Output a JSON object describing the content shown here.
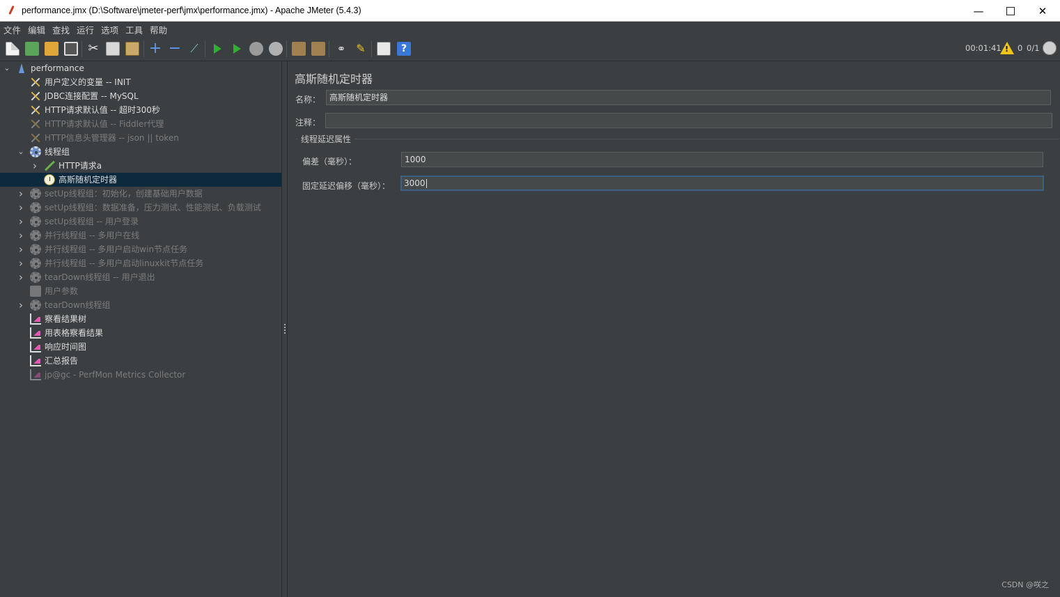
{
  "window": {
    "title": "performance.jmx (D:\\Software\\jmeter-perf\\jmx\\performance.jmx) - Apache JMeter (5.4.3)",
    "minimize": "—",
    "maximize": "",
    "close": "✕"
  },
  "menu": [
    "文件",
    "编辑",
    "查找",
    "运行",
    "选项",
    "工具",
    "帮助"
  ],
  "toolbar_right": {
    "elapsed": "00:01:41",
    "warnings": "0",
    "threads": "0/1"
  },
  "tree": [
    {
      "label": "performance",
      "icon": "flask-icon",
      "level": 0,
      "expander": "down",
      "disabled": false
    },
    {
      "label": "用户定义的变量 -- INIT",
      "icon": "config-icon",
      "level": 1,
      "expander": "",
      "disabled": false
    },
    {
      "label": "JDBC连接配置 -- MySQL",
      "icon": "config-icon",
      "level": 1,
      "expander": "",
      "disabled": false
    },
    {
      "label": "HTTP请求默认值 -- 超时300秒",
      "icon": "config-icon",
      "level": 1,
      "expander": "",
      "disabled": false
    },
    {
      "label": "HTTP请求默认值 -- Fiddler代理",
      "icon": "config-icon",
      "level": 1,
      "expander": "",
      "disabled": true
    },
    {
      "label": "HTTP信息头管理器 -- json || token",
      "icon": "config-icon",
      "level": 1,
      "expander": "",
      "disabled": true
    },
    {
      "label": "线程组",
      "icon": "gear-icon",
      "level": 1,
      "expander": "down",
      "disabled": false
    },
    {
      "label": "HTTP请求a",
      "icon": "pen-icon",
      "level": 2,
      "expander": "right",
      "disabled": false
    },
    {
      "label": "高斯随机定时器",
      "icon": "timer-icon",
      "level": 2,
      "expander": "",
      "disabled": false,
      "selected": true
    },
    {
      "label": "setUp线程组：初始化，创建基础用户数据",
      "icon": "gear-icon",
      "level": 1,
      "expander": "right",
      "disabled": true
    },
    {
      "label": "setUp线程组：数据准备，压力测试、性能测试、负载测试",
      "icon": "gear-icon",
      "level": 1,
      "expander": "right",
      "disabled": true
    },
    {
      "label": "setUp线程组 -- 用户登录",
      "icon": "gear-icon",
      "level": 1,
      "expander": "right",
      "disabled": true
    },
    {
      "label": "并行线程组 -- 多用户在线",
      "icon": "gear-icon",
      "level": 1,
      "expander": "right",
      "disabled": true
    },
    {
      "label": "并行线程组 -- 多用户启动win节点任务",
      "icon": "gear-icon",
      "level": 1,
      "expander": "right",
      "disabled": true
    },
    {
      "label": "并行线程组 -- 多用户启动linuxkit节点任务",
      "icon": "gear-icon",
      "level": 1,
      "expander": "right",
      "disabled": true
    },
    {
      "label": "tearDown线程组 -- 用户退出",
      "icon": "gear-icon",
      "level": 1,
      "expander": "right",
      "disabled": true
    },
    {
      "label": "用户参数",
      "icon": "doc-icon",
      "level": 1,
      "expander": "",
      "disabled": true
    },
    {
      "label": "tearDown线程组",
      "icon": "gear-icon",
      "level": 1,
      "expander": "right",
      "disabled": true
    },
    {
      "label": "察看结果树",
      "icon": "chart-icon",
      "level": 1,
      "expander": "",
      "disabled": false
    },
    {
      "label": "用表格察看结果",
      "icon": "chart-icon",
      "level": 1,
      "expander": "",
      "disabled": false
    },
    {
      "label": "响应时间图",
      "icon": "chart-icon",
      "level": 1,
      "expander": "",
      "disabled": false
    },
    {
      "label": "汇总报告",
      "icon": "chart-icon",
      "level": 1,
      "expander": "",
      "disabled": false
    },
    {
      "label": "jp@gc - PerfMon Metrics Collector",
      "icon": "chart-icon",
      "level": 1,
      "expander": "",
      "disabled": true
    }
  ],
  "editor": {
    "heading": "高斯随机定时器",
    "name_label": "名称：",
    "name_value": "高斯随机定时器",
    "comment_label": "注释：",
    "comment_value": "",
    "group_title": "线程延迟属性",
    "deviation_label": "偏差（毫秒）：",
    "deviation_value": "1000",
    "offset_label": "固定延迟偏移（毫秒）：",
    "offset_value": "3000"
  },
  "watermark": "CSDN @咲之"
}
